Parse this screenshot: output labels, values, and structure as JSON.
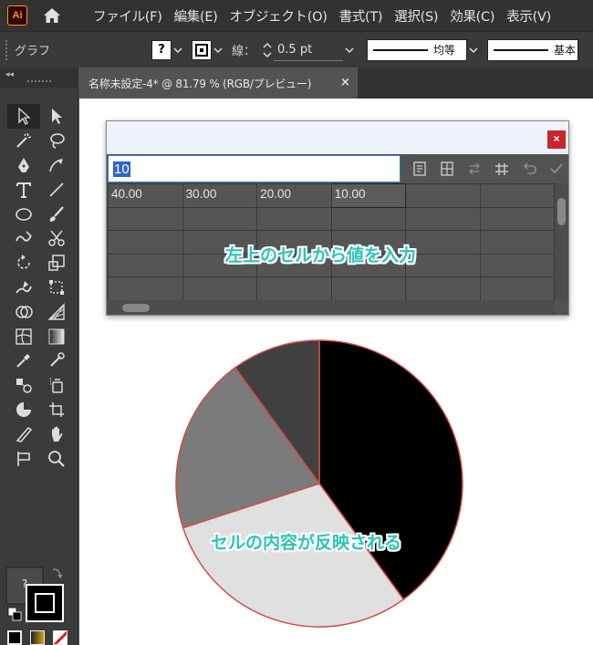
{
  "app": {
    "logo": "Ai",
    "menus": [
      "ファイル(F)",
      "編集(E)",
      "オブジェクト(O)",
      "書式(T)",
      "選択(S)",
      "効果(C)",
      "表示(V)"
    ]
  },
  "control_bar": {
    "selection_label": "グラフ",
    "fill_swatch": "?",
    "stroke_label": "線：",
    "stroke_value": "0.5 pt",
    "profile_label": "均等",
    "brush_label": "基本"
  },
  "document": {
    "tab_title": "名称未設定-4* @ 81.79 % (RGB/プレビュー)",
    "tab_close": "×"
  },
  "graph_window": {
    "close_label": "×",
    "input_value": "10",
    "rows": [
      [
        "40.00",
        "30.00",
        "20.00",
        "10.00",
        "",
        ""
      ],
      [
        "",
        "",
        "",
        "",
        "",
        ""
      ],
      [
        "",
        "",
        "",
        "",
        "",
        ""
      ],
      [
        "",
        "",
        "",
        "",
        "",
        ""
      ],
      [
        "",
        "",
        "",
        "",
        "",
        ""
      ]
    ]
  },
  "toolbar": {
    "fill_swatch": "?"
  },
  "callouts": {
    "top": "左上のセルから値を入力",
    "bottom": "セルの内容が反映される"
  },
  "chart_data": {
    "type": "pie",
    "values": [
      40,
      30,
      20,
      10
    ],
    "colors": [
      "#000000",
      "#e0e0e0",
      "#7b7b7b",
      "#404040"
    ],
    "stroke": "#d24b4b",
    "start_angle_deg": -90
  }
}
